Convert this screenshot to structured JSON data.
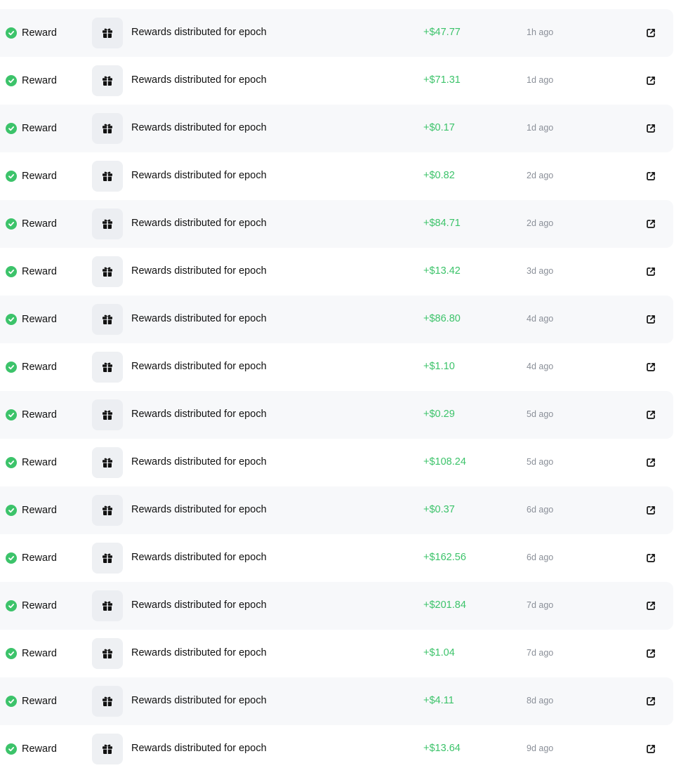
{
  "colors": {
    "amount_green": "#3cc36a",
    "status_green": "#3cc36a",
    "row_shade": "#f7f8fa",
    "time_gray": "#8a8f98"
  },
  "icons": {
    "status": "check-circle-icon",
    "type": "gift-icon",
    "link": "external-link-icon"
  },
  "transactions": [
    {
      "status": "Reward",
      "description": "Rewards distributed for epoch",
      "amount": "+$47.77",
      "time": "1h ago"
    },
    {
      "status": "Reward",
      "description": "Rewards distributed for epoch",
      "amount": "+$71.31",
      "time": "1d ago"
    },
    {
      "status": "Reward",
      "description": "Rewards distributed for epoch",
      "amount": "+$0.17",
      "time": "1d ago"
    },
    {
      "status": "Reward",
      "description": "Rewards distributed for epoch",
      "amount": "+$0.82",
      "time": "2d ago"
    },
    {
      "status": "Reward",
      "description": "Rewards distributed for epoch",
      "amount": "+$84.71",
      "time": "2d ago"
    },
    {
      "status": "Reward",
      "description": "Rewards distributed for epoch",
      "amount": "+$13.42",
      "time": "3d ago"
    },
    {
      "status": "Reward",
      "description": "Rewards distributed for epoch",
      "amount": "+$86.80",
      "time": "4d ago"
    },
    {
      "status": "Reward",
      "description": "Rewards distributed for epoch",
      "amount": "+$1.10",
      "time": "4d ago"
    },
    {
      "status": "Reward",
      "description": "Rewards distributed for epoch",
      "amount": "+$0.29",
      "time": "5d ago"
    },
    {
      "status": "Reward",
      "description": "Rewards distributed for epoch",
      "amount": "+$108.24",
      "time": "5d ago"
    },
    {
      "status": "Reward",
      "description": "Rewards distributed for epoch",
      "amount": "+$0.37",
      "time": "6d ago"
    },
    {
      "status": "Reward",
      "description": "Rewards distributed for epoch",
      "amount": "+$162.56",
      "time": "6d ago"
    },
    {
      "status": "Reward",
      "description": "Rewards distributed for epoch",
      "amount": "+$201.84",
      "time": "7d ago"
    },
    {
      "status": "Reward",
      "description": "Rewards distributed for epoch",
      "amount": "+$1.04",
      "time": "7d ago"
    },
    {
      "status": "Reward",
      "description": "Rewards distributed for epoch",
      "amount": "+$4.11",
      "time": "8d ago"
    },
    {
      "status": "Reward",
      "description": "Rewards distributed for epoch",
      "amount": "+$13.64",
      "time": "9d ago"
    }
  ]
}
